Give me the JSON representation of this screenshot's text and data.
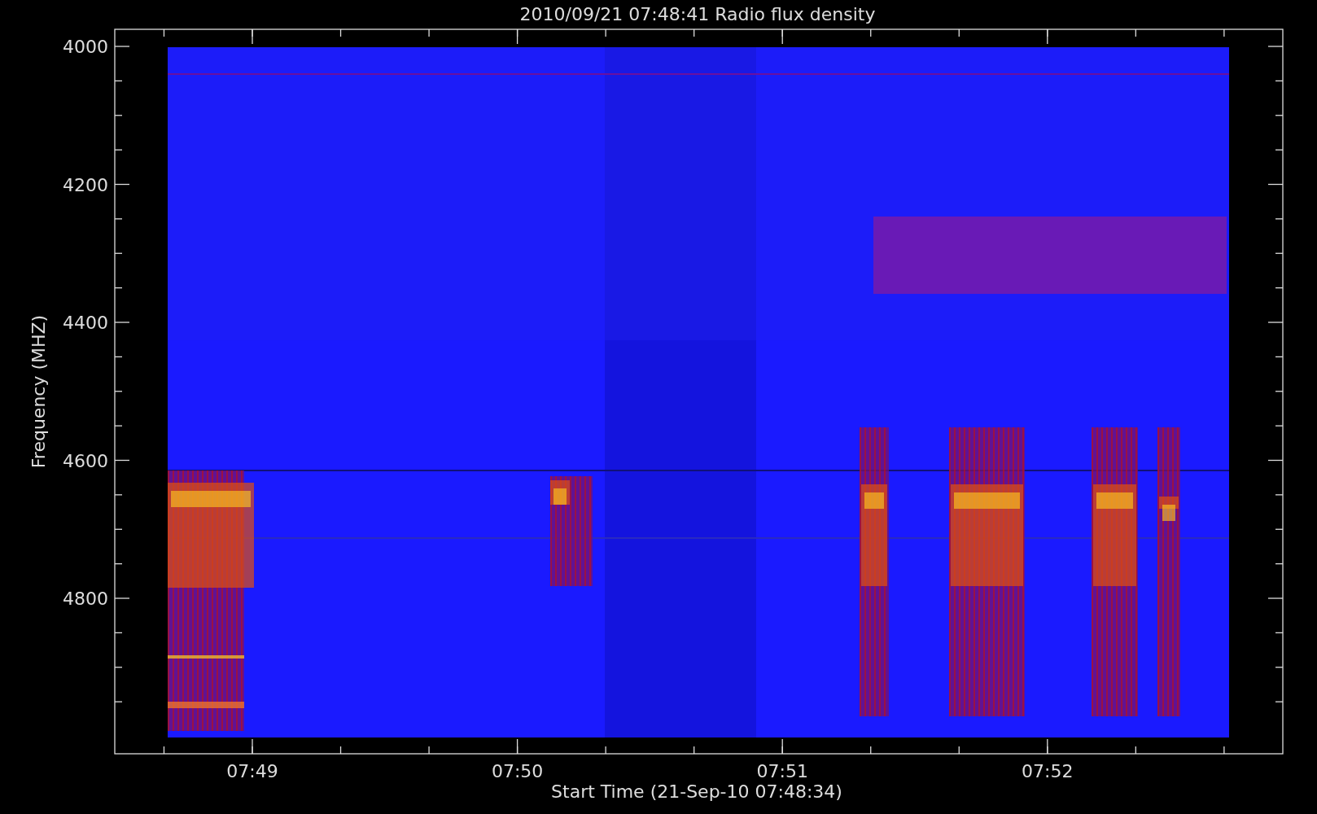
{
  "title": "2010/09/21 07:48:41 Radio flux density",
  "y_axis": {
    "label": "Frequency (MHZ)",
    "ticks": [
      "4000",
      "4200",
      "4400",
      "4600",
      "4800"
    ]
  },
  "x_axis": {
    "label": "Start Time (21-Sep-10 07:48:34)",
    "ticks": [
      "07:49",
      "07:50",
      "07:51",
      "07:52"
    ]
  }
}
